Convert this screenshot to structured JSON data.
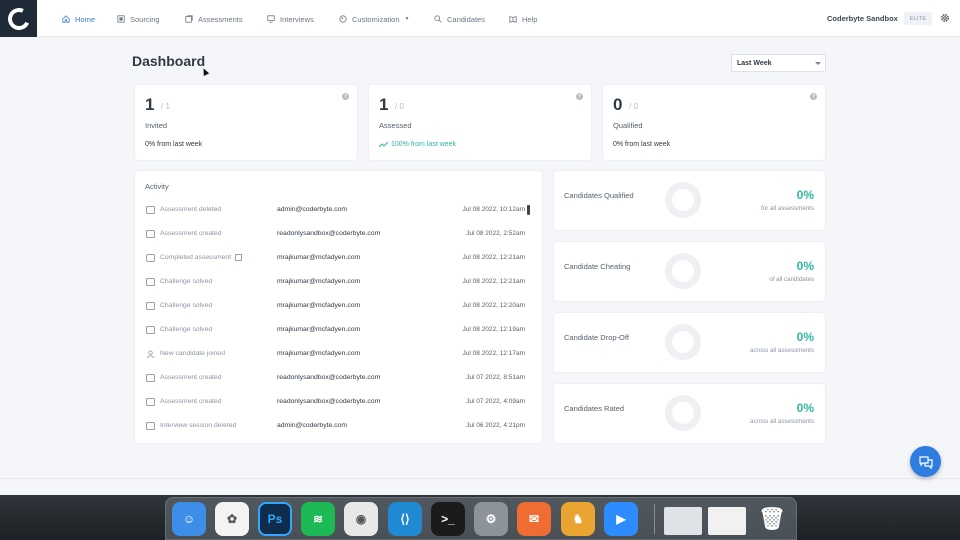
{
  "nav": {
    "items": [
      {
        "label": "Home",
        "active": true
      },
      {
        "label": "Sourcing"
      },
      {
        "label": "Assessments"
      },
      {
        "label": "Interviews"
      },
      {
        "label": "Customization",
        "dropdown": true
      },
      {
        "label": "Candidates"
      },
      {
        "label": "Help"
      }
    ],
    "org_name": "Coderbyte Sandbox",
    "plan_badge": "ELITE"
  },
  "page": {
    "title": "Dashboard",
    "period": "Last Week"
  },
  "stats": [
    {
      "value": "1",
      "total": "/ 1",
      "label": "Invited",
      "change": "0% from last week",
      "trend": "flat"
    },
    {
      "value": "1",
      "total": "/ 0",
      "label": "Assessed",
      "change": "100% from last week",
      "trend": "up"
    },
    {
      "value": "0",
      "total": "/ 0",
      "label": "Qualified",
      "change": "0% from last week",
      "trend": "flat"
    }
  ],
  "activity": {
    "title": "Activity",
    "rows": [
      {
        "event": "Assessment deleted",
        "who": "admin@coderbyte.com",
        "when": "Jul 08 2022, 10:12am",
        "icon": "image-icon"
      },
      {
        "event": "Assessment created",
        "who": "readonlysandbox@coderbyte.com",
        "when": "Jul 08 2022, 2:52am",
        "icon": "image-icon"
      },
      {
        "event": "Completed assessment",
        "who": "mrajkumar@mcfadyen.com",
        "when": "Jul 08 2022, 12:21am",
        "icon": "check-square-icon",
        "external": true
      },
      {
        "event": "Challenge solved",
        "who": "mrajkumar@mcfadyen.com",
        "when": "Jul 08 2022, 12:21am",
        "icon": "image-icon"
      },
      {
        "event": "Challenge solved",
        "who": "mrajkumar@mcfadyen.com",
        "when": "Jul 08 2022, 12:20am",
        "icon": "image-icon"
      },
      {
        "event": "Challenge solved",
        "who": "mrajkumar@mcfadyen.com",
        "when": "Jul 08 2022, 12:19am",
        "icon": "image-icon"
      },
      {
        "event": "New candidate joined",
        "who": "mrajkumar@mcfadyen.com",
        "when": "Jul 08 2022, 12:17am",
        "icon": "user-icon"
      },
      {
        "event": "Assessment created",
        "who": "readonlysandbox@coderbyte.com",
        "when": "Jul 07 2022, 8:51am",
        "icon": "image-icon"
      },
      {
        "event": "Assessment created",
        "who": "readonlysandbox@coderbyte.com",
        "when": "Jul 07 2022, 4:09am",
        "icon": "image-icon"
      },
      {
        "event": "Interview session deleted",
        "who": "admin@coderbyte.com",
        "when": "Jul 06 2022, 4:21pm",
        "icon": "image-icon"
      }
    ]
  },
  "metrics": [
    {
      "title": "Candidates Qualified",
      "value": "0%",
      "sub": "for all assessments"
    },
    {
      "title": "Candidate Cheating",
      "value": "0%",
      "sub": "of all candidates"
    },
    {
      "title": "Candidate Drop-Off",
      "value": "0%",
      "sub": "across all assessments"
    },
    {
      "title": "Candidates Rated",
      "value": "0%",
      "sub": "across all assessments"
    }
  ],
  "colors": {
    "accent": "#3a7bd5",
    "positive": "#2eb8a2",
    "chat": "#2f7de1"
  },
  "dock": [
    {
      "name": "finder-icon",
      "glyph": "☺",
      "bg": "#3d8ee8"
    },
    {
      "name": "photos-icon",
      "glyph": "✿",
      "bg": "#f3f3f3"
    },
    {
      "name": "photoshop-icon",
      "glyph": "Ps",
      "bg": "#0e2d4d"
    },
    {
      "name": "spotify-icon",
      "glyph": "≋",
      "bg": "#1db954"
    },
    {
      "name": "chrome-icon",
      "glyph": "◉",
      "bg": "#e8e8e8"
    },
    {
      "name": "vscode-icon",
      "glyph": "⟨⟩",
      "bg": "#1f8ad2"
    },
    {
      "name": "terminal-icon",
      "glyph": ">_",
      "bg": "#1b1b1b"
    },
    {
      "name": "system-preferences-icon",
      "glyph": "⚙",
      "bg": "#8d939a"
    },
    {
      "name": "postman-icon",
      "glyph": "✉",
      "bg": "#ef6c33"
    },
    {
      "name": "sequel-pro-icon",
      "glyph": "♞",
      "bg": "#e9a431"
    },
    {
      "name": "zoom-icon",
      "glyph": "▶",
      "bg": "#2d8cff"
    },
    {
      "name": "window-thumbnail-icon",
      "glyph": "",
      "bg": "#dfe3e7"
    },
    {
      "name": "chrome-window-thumbnail-icon",
      "glyph": "",
      "bg": "#f1f1f1"
    },
    {
      "name": "trash-icon",
      "glyph": "🗑",
      "bg": "transparent"
    }
  ]
}
